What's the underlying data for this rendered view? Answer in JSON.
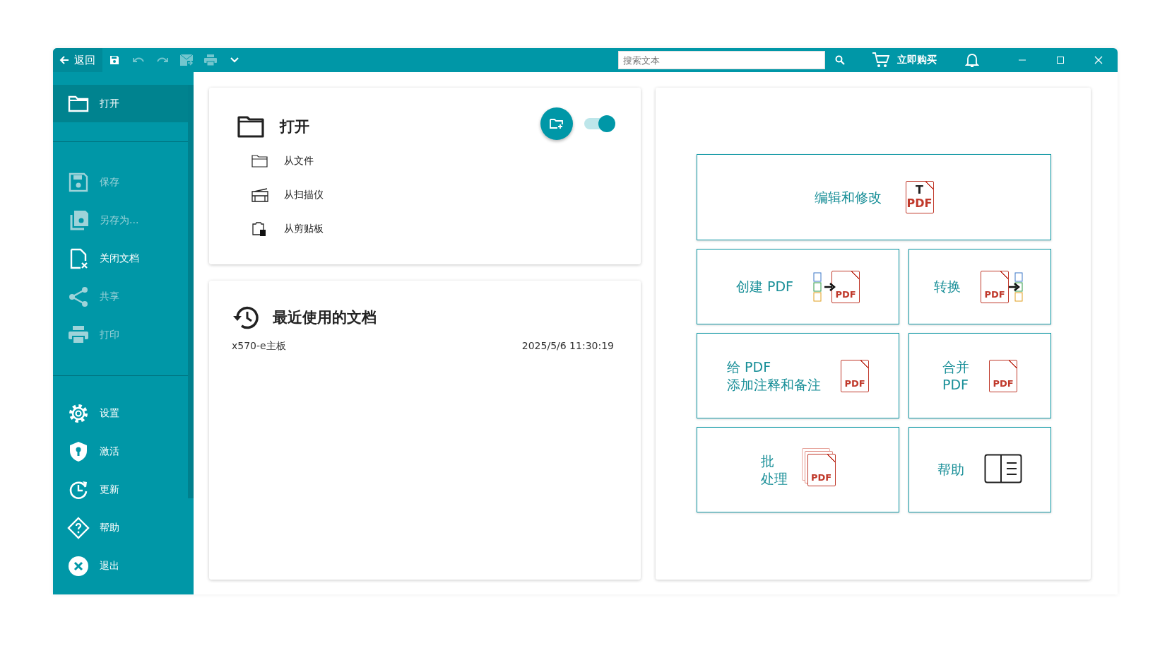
{
  "toolbar": {
    "back": {
      "label": "返回"
    },
    "tools": [
      {
        "kind": "save",
        "disabled": false
      },
      {
        "kind": "undo",
        "disabled": true
      },
      {
        "kind": "redo",
        "disabled": true
      },
      {
        "kind": "mail",
        "disabled": true
      },
      {
        "kind": "print",
        "disabled": true
      },
      {
        "kind": "dropdown",
        "disabled": false
      }
    ],
    "search": {
      "placeholder": "搜索文本"
    },
    "buy": {
      "label": "立即购买"
    }
  },
  "sidebar": {
    "sections": [
      [
        {
          "kind": "folder",
          "label": "打开",
          "selected": true,
          "disabled": false
        }
      ],
      [
        {
          "kind": "save",
          "label": "保存",
          "selected": false,
          "disabled": true
        },
        {
          "kind": "save-as",
          "label": "另存为...",
          "selected": false,
          "disabled": true
        },
        {
          "kind": "close-doc",
          "label": "关闭文档",
          "selected": false,
          "disabled": false
        },
        {
          "kind": "share",
          "label": "共享",
          "selected": false,
          "disabled": true
        },
        {
          "kind": "print",
          "label": "打印",
          "selected": false,
          "disabled": true
        }
      ],
      [
        {
          "kind": "settings",
          "label": "设置",
          "selected": false,
          "disabled": false
        },
        {
          "kind": "shield",
          "label": "激活",
          "selected": false,
          "disabled": false
        },
        {
          "kind": "update",
          "label": "更新",
          "selected": false,
          "disabled": false
        },
        {
          "kind": "help",
          "label": "帮助",
          "selected": false,
          "disabled": false
        },
        {
          "kind": "exit",
          "label": "退出",
          "selected": false,
          "disabled": false
        }
      ]
    ]
  },
  "open_panel": {
    "title": "打开",
    "toggle": {
      "on": true
    },
    "sources": [
      {
        "kind": "file",
        "label": "从文件"
      },
      {
        "kind": "scanner",
        "label": "从扫描仪"
      },
      {
        "kind": "clipboard",
        "label": "从剪贴板"
      }
    ]
  },
  "recent_panel": {
    "title": "最近使用的文档",
    "documents": [
      {
        "name": "x570-e主板",
        "date": "2025/5/6 11:30:19"
      }
    ]
  },
  "tiles": [
    {
      "kind": "edit",
      "lines": [
        "编辑和修改"
      ],
      "icon_text": "PDF",
      "icon_mark": "T"
    },
    {
      "kind": "create",
      "lines": [
        "创建 PDF"
      ],
      "icon_text": "PDF"
    },
    {
      "kind": "convert",
      "lines": [
        "转换"
      ],
      "icon_text": "PDF"
    },
    {
      "kind": "annotate",
      "lines": [
        "给 PDF",
        "添加注释和备注"
      ],
      "icon_text": "PDF"
    },
    {
      "kind": "merge",
      "lines": [
        "合并",
        "PDF"
      ],
      "icon_text": "PDF"
    },
    {
      "kind": "batch",
      "lines": [
        "批",
        "处理"
      ],
      "icon_text": "PDF"
    },
    {
      "kind": "help",
      "lines": [
        "帮助"
      ]
    }
  ]
}
